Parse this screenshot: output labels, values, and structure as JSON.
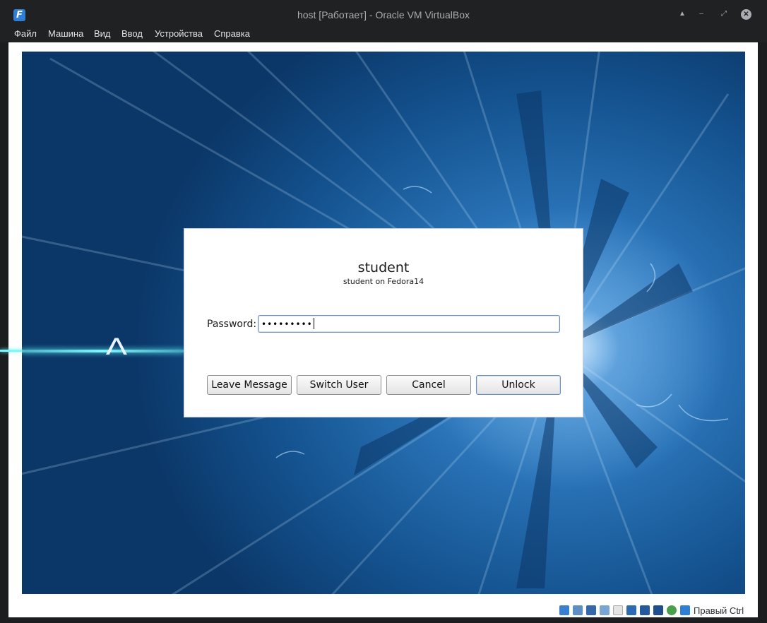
{
  "window": {
    "title": "host [Работает] - Oracle VM VirtualBox",
    "app_icon_glyph": "F"
  },
  "menu": {
    "items": [
      "Файл",
      "Машина",
      "Вид",
      "Ввод",
      "Устройства",
      "Справка"
    ]
  },
  "lock_dialog": {
    "user_name": "student",
    "user_subtitle": "student on Fedora14",
    "password_label": "Password:",
    "password_value": "•••••••••",
    "buttons": {
      "leave_message": "Leave Message",
      "switch_user": "Switch User",
      "cancel": "Cancel",
      "unlock": "Unlock"
    }
  },
  "statusbar": {
    "icons": [
      "hard-disk-icon",
      "optical-drive-icon",
      "network-icon",
      "usb-icon",
      "shared-folders-icon",
      "display-icon",
      "video-capture-icon",
      "virtualization-icon",
      "mouse-integration-icon",
      "keyboard-capture-icon"
    ],
    "host_key": "Правый Ctrl"
  },
  "colors": {
    "chrome": "#1f2123",
    "desktop_blue": "#14528f",
    "accent_glow": "#7ff6ff"
  }
}
